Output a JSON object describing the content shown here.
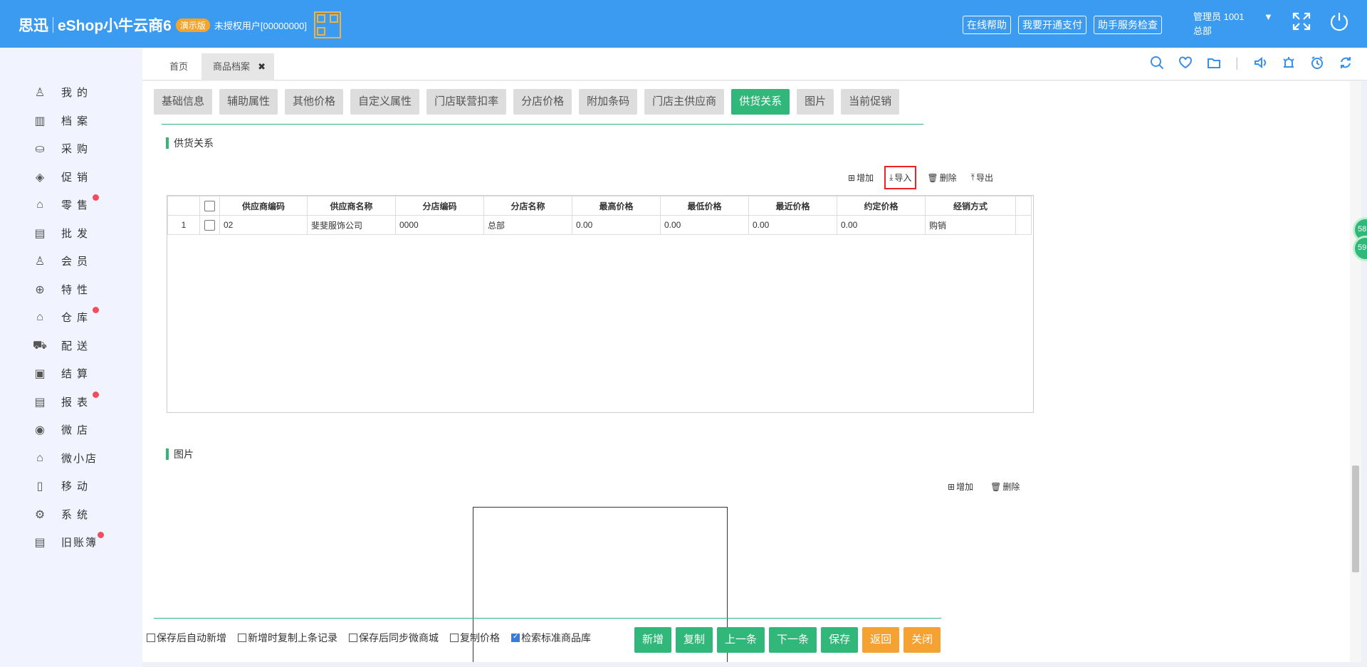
{
  "header": {
    "brand_name": "思迅",
    "product": "eShop小牛云商6",
    "demo_badge": "演示版",
    "unauth_user": "未授权用户[00000000]",
    "buttons": [
      "在线帮助",
      "我要开通支付",
      "助手服务检查"
    ],
    "user_line1": "管理员 1001",
    "user_line2": "总部",
    "caret": "▼",
    "icons": [
      "expand-icon",
      "power-icon"
    ]
  },
  "sidebar": {
    "items": [
      {
        "label": "我的",
        "icon": "user-icon",
        "badge": false
      },
      {
        "label": "档案",
        "icon": "archive-icon",
        "badge": false
      },
      {
        "label": "采购",
        "icon": "basket-icon",
        "badge": false
      },
      {
        "label": "促销",
        "icon": "tag-icon",
        "badge": false
      },
      {
        "label": "零售",
        "icon": "bag-icon",
        "badge": true
      },
      {
        "label": "批发",
        "icon": "wholesale-icon",
        "badge": false
      },
      {
        "label": "会员",
        "icon": "member-icon",
        "badge": false
      },
      {
        "label": "特性",
        "icon": "target-icon",
        "badge": false
      },
      {
        "label": "仓库",
        "icon": "warehouse-icon",
        "badge": true
      },
      {
        "label": "配送",
        "icon": "truck-icon",
        "badge": false
      },
      {
        "label": "结算",
        "icon": "settle-icon",
        "badge": false
      },
      {
        "label": "报表",
        "icon": "report-icon",
        "badge": true
      },
      {
        "label": "微店",
        "icon": "wechat-shop-icon",
        "badge": false
      },
      {
        "label": "微小店",
        "icon": "mini-shop-icon",
        "badge": false
      },
      {
        "label": "移动",
        "icon": "mobile-icon",
        "badge": false
      },
      {
        "label": "系统",
        "icon": "gear-icon",
        "badge": false
      },
      {
        "label": "旧账簿",
        "icon": "ledger-icon",
        "badge": true
      }
    ]
  },
  "tabs": {
    "home": "首页",
    "active": "商品档案",
    "close": "✖",
    "toolbar_icons": [
      "search-icon",
      "heart-icon",
      "folder-icon",
      "speaker-icon",
      "alarm-icon",
      "clock-icon",
      "refresh-icon"
    ]
  },
  "subtabs": [
    "基础信息",
    "辅助属性",
    "其他价格",
    "自定义属性",
    "门店联营扣率",
    "分店价格",
    "附加条码",
    "门店主供应商",
    "供货关系",
    "图片",
    "当前促销"
  ],
  "supply": {
    "title": "供货关系",
    "tools": {
      "add": "增加",
      "import": "导入",
      "delete": "删除",
      "export": "导出"
    },
    "columns": [
      "供应商编码",
      "供应商名称",
      "分店编码",
      "分店名称",
      "最高价格",
      "最低价格",
      "最近价格",
      "约定价格",
      "经销方式"
    ],
    "rows": [
      {
        "no": "1",
        "cells": [
          "02",
          "斐斐服饰公司",
          "0000",
          "总部",
          "0.00",
          "0.00",
          "0.00",
          "0.00",
          "购销"
        ]
      }
    ]
  },
  "images": {
    "title": "图片",
    "tools": {
      "add": "增加",
      "delete": "删除"
    }
  },
  "bottom": {
    "options": [
      {
        "label": "保存后自动新增",
        "checked": false
      },
      {
        "label": "新增时复制上条记录",
        "checked": false
      },
      {
        "label": "保存后同步微商城",
        "checked": false
      },
      {
        "label": "复制价格",
        "checked": false
      },
      {
        "label": "检索标准商品库",
        "checked": true
      }
    ],
    "actions": [
      {
        "label": "新增",
        "color": "#31b77a"
      },
      {
        "label": "复制",
        "color": "#31b77a"
      },
      {
        "label": "上一条",
        "color": "#31b77a"
      },
      {
        "label": "下一条",
        "color": "#31b77a"
      },
      {
        "label": "保存",
        "color": "#31b77a"
      },
      {
        "label": "返回",
        "color": "#f6a233"
      },
      {
        "label": "关闭",
        "color": "#f6a233"
      }
    ]
  },
  "side_bubbles": [
    "58",
    "59"
  ],
  "colors": {
    "header": "#3a9bf1",
    "accent": "#31b77a",
    "orange": "#f6a233",
    "badge": "#f24d5d",
    "highlight": "#e22222"
  }
}
